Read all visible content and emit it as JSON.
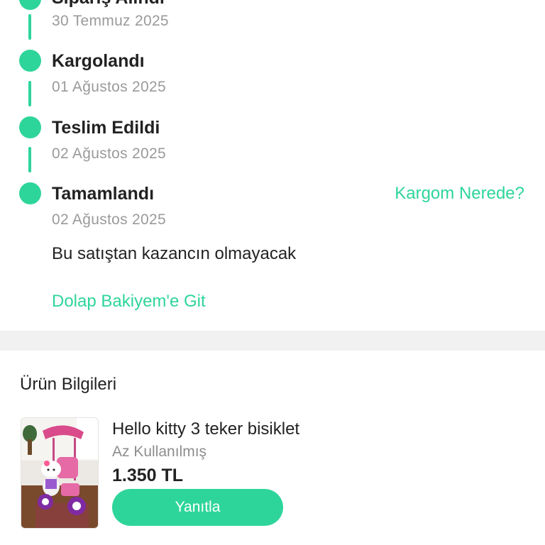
{
  "theme": {
    "accent": "#2ed59a"
  },
  "order_status": {
    "steps": [
      {
        "title": "Sipariş Alındı",
        "date": "30 Temmuz 2025"
      },
      {
        "title": "Kargolandı",
        "date": "01 Ağustos 2025"
      },
      {
        "title": "Teslim Edildi",
        "date": "02 Ağustos 2025"
      },
      {
        "title": "Tamamlandı",
        "date": "02 Ağustos 2025"
      }
    ],
    "track_link_label": "Kargom Nerede?",
    "earnings_note": "Bu satıştan kazancın olmayacak",
    "balance_link_label": "Dolap Bakiyem'e Git"
  },
  "product_section": {
    "title": "Ürün Bilgileri",
    "product": {
      "name": "Hello kitty 3 teker bisiklet",
      "condition": "Az Kullanılmış",
      "price": "1.350 TL",
      "thumbnail": "pink-kids-tricycle-photo"
    },
    "reply_button_label": "Yanıtla"
  }
}
